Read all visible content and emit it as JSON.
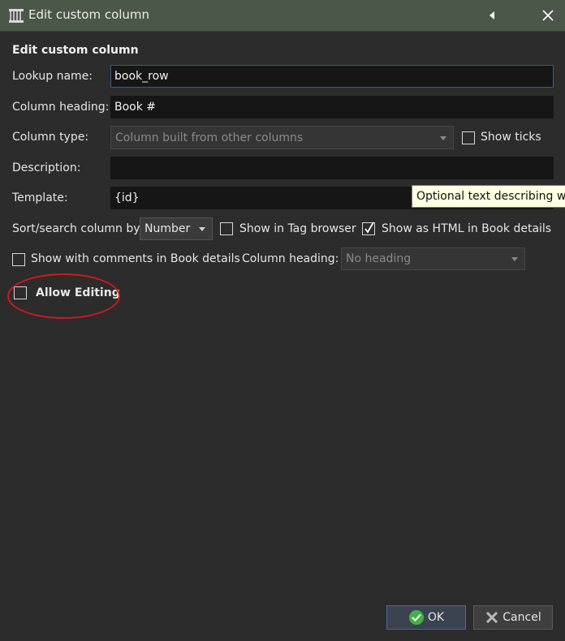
{
  "window": {
    "title": "Edit custom column"
  },
  "section_heading": "Edit custom column",
  "lookup": {
    "label": "Lookup name:",
    "value": "book_row"
  },
  "heading": {
    "label": "Column heading:",
    "value": "Book #"
  },
  "column_type": {
    "label": "Column type:",
    "value": "Column built from other columns"
  },
  "show_ticks": {
    "label": "Show ticks",
    "checked": false
  },
  "description": {
    "label": "Description:",
    "value": ""
  },
  "template": {
    "label": "Template:",
    "value": "{id}"
  },
  "tooltip": "Optional text describing wha",
  "sort_search": {
    "label": "Sort/search column by",
    "value": "Number"
  },
  "show_tag_browser": {
    "label": "Show in Tag browser",
    "checked": false
  },
  "show_html": {
    "label": "Show as HTML in Book details",
    "checked": true
  },
  "show_comments": {
    "label": "Show with comments in Book details",
    "checked": false
  },
  "comments_heading": {
    "label": "Column heading:",
    "value": "No heading"
  },
  "allow_editing": {
    "label": "Allow Editing",
    "checked": false
  },
  "buttons": {
    "ok": "OK",
    "cancel": "Cancel"
  },
  "colors": {
    "titlebar": "#4b5749",
    "accent_circle": "#d11a1a",
    "ok_icon": "#43b04a"
  }
}
